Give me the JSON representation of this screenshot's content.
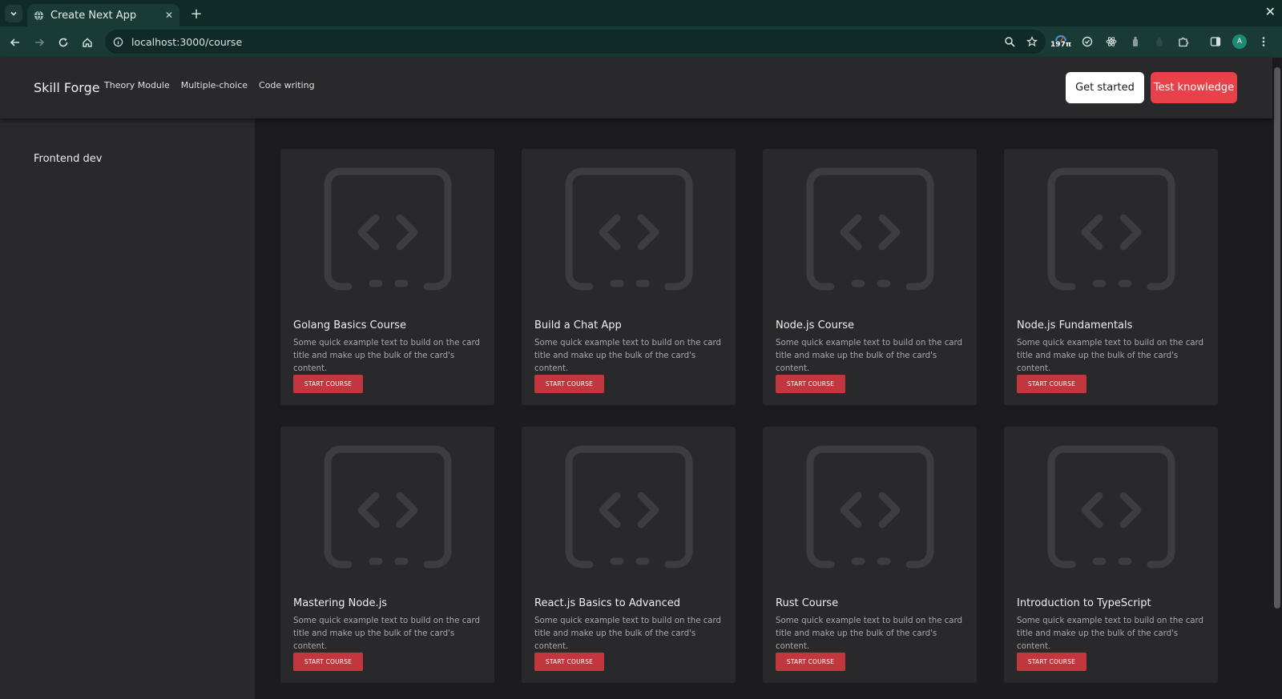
{
  "browser": {
    "tab_title": "Create Next App",
    "url": "localhost:3000/course",
    "extension_badge": "197π",
    "profile_initial": "A"
  },
  "nav": {
    "brand": "Skill Forge",
    "links": [
      "Theory Module",
      "Multiple-choice",
      "Code writing"
    ],
    "get_started": "Get started",
    "test_knowledge": "Test knowledge"
  },
  "sidebar": {
    "items": [
      {
        "label": "Frontend dev"
      }
    ]
  },
  "cards": [
    {
      "title": "Golang Basics Course",
      "text": "Some quick example text to build on the card title and make up the bulk of the card's content.",
      "button": "START COURSE"
    },
    {
      "title": "Build a Chat App",
      "text": "Some quick example text to build on the card title and make up the bulk of the card's content.",
      "button": "START COURSE"
    },
    {
      "title": "Node.js Course",
      "text": "Some quick example text to build on the card title and make up the bulk of the card's content.",
      "button": "START COURSE"
    },
    {
      "title": "Node.js Fundamentals",
      "text": "Some quick example text to build on the card title and make up the bulk of the card's content.",
      "button": "START COURSE"
    },
    {
      "title": "Mastering Node.js",
      "text": "Some quick example text to build on the card title and make up the bulk of the card's content.",
      "button": "START COURSE"
    },
    {
      "title": "React.js Basics to Advanced",
      "text": "Some quick example text to build on the card title and make up the bulk of the card's content.",
      "button": "START COURSE"
    },
    {
      "title": "Rust Course",
      "text": "Some quick example text to build on the card title and make up the bulk of the card's content.",
      "button": "START COURSE"
    },
    {
      "title": "Introduction to TypeScript",
      "text": "Some quick example text to build on the card title and make up the bulk of the card's content.",
      "button": "START COURSE"
    }
  ],
  "colors": {
    "accent_red": "#e8414a",
    "card_button_red": "#c2363e",
    "surface": "#29292b",
    "background": "#1c1c1e",
    "browser_chrome": "#1a3a36"
  }
}
